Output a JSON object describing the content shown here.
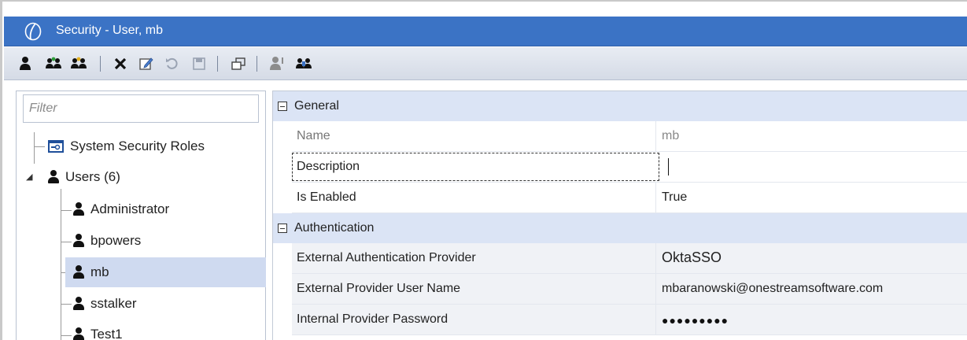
{
  "window": {
    "title": "Security - User, mb"
  },
  "toolbar": {
    "items": [
      {
        "icon": "user-icon"
      },
      {
        "icon": "user-group-add-icon"
      },
      {
        "icon": "user-group-icon"
      },
      {
        "icon": "delete-icon"
      },
      {
        "icon": "edit-icon"
      },
      {
        "icon": "refresh-icon"
      },
      {
        "icon": "save-icon"
      },
      {
        "icon": "copy-window-icon"
      },
      {
        "icon": "user-info-icon"
      },
      {
        "icon": "user-swap-icon"
      }
    ]
  },
  "filter": {
    "placeholder": "Filter"
  },
  "tree": {
    "roles_label": "System Security Roles",
    "users_label": "Users (6)",
    "users": [
      "Administrator",
      "bpowers",
      "mb",
      "sstalker",
      "Test1"
    ],
    "selected": "mb"
  },
  "properties": {
    "general": {
      "header": "General",
      "rows": [
        {
          "name": "Name",
          "value": "mb"
        },
        {
          "name": "Description",
          "value": ""
        },
        {
          "name": "Is Enabled",
          "value": "True"
        }
      ]
    },
    "authentication": {
      "header": "Authentication",
      "rows": [
        {
          "name": "External Authentication Provider",
          "value": "OktaSSO"
        },
        {
          "name": "External Provider User Name",
          "value": "mbaranowski@onestreamsoftware.com"
        },
        {
          "name": "Internal Provider Password",
          "value": "●●●●●●●●●"
        }
      ]
    }
  },
  "colors": {
    "titlebar": "#3b73c5",
    "section_header": "#dbe4f5",
    "selection": "#cfdaf0",
    "toolbar_green": "#2e9e3a"
  }
}
